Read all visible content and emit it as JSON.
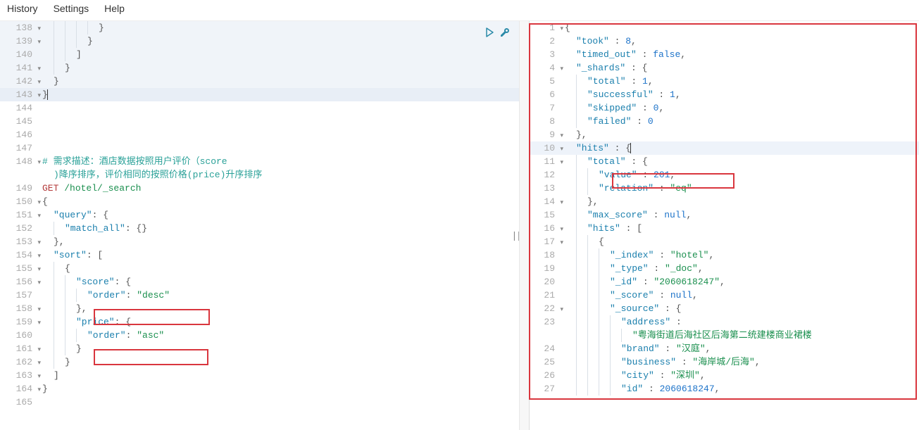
{
  "menu": {
    "history": "History",
    "settings": "Settings",
    "help": "Help"
  },
  "left": {
    "lines": [
      {
        "n": 138,
        "fold": true,
        "shade": true,
        "tokens": [
          [
            "indent",
            5
          ],
          [
            "punc",
            "}"
          ]
        ]
      },
      {
        "n": 139,
        "fold": true,
        "shade": true,
        "tokens": [
          [
            "indent",
            4
          ],
          [
            "punc",
            "}"
          ]
        ]
      },
      {
        "n": 140,
        "fold": false,
        "shade": true,
        "tokens": [
          [
            "indent",
            3
          ],
          [
            "punc",
            "]"
          ]
        ]
      },
      {
        "n": 141,
        "fold": true,
        "shade": true,
        "tokens": [
          [
            "indent",
            2
          ],
          [
            "punc",
            "}"
          ]
        ]
      },
      {
        "n": 142,
        "fold": true,
        "shade": true,
        "tokens": [
          [
            "indent",
            1
          ],
          [
            "punc",
            "}"
          ]
        ]
      },
      {
        "n": 143,
        "fold": true,
        "sel": true,
        "tokens": [
          [
            "punc",
            "}"
          ],
          [
            "cursor",
            ""
          ]
        ]
      },
      {
        "n": 144,
        "fold": false,
        "tokens": []
      },
      {
        "n": 145,
        "fold": false,
        "tokens": []
      },
      {
        "n": 146,
        "fold": false,
        "tokens": []
      },
      {
        "n": 147,
        "fold": false,
        "tokens": []
      },
      {
        "n": 148,
        "fold": true,
        "tokens": [
          [
            "cmt",
            "# 需求描述：酒店数据按照用户评价（score"
          ]
        ]
      },
      {
        "n": "",
        "fold": false,
        "tokens": [
          [
            "indent",
            1
          ],
          [
            "cmt",
            ")降序排序，评价相同的按照价格(price)升序排序"
          ]
        ]
      },
      {
        "n": 149,
        "fold": false,
        "tokens": [
          [
            "kw",
            "GET"
          ],
          [
            "txt",
            " "
          ],
          [
            "path",
            "/hotel/_search"
          ]
        ]
      },
      {
        "n": 150,
        "fold": true,
        "tokens": [
          [
            "punc",
            "{"
          ]
        ]
      },
      {
        "n": 151,
        "fold": true,
        "tokens": [
          [
            "indent",
            1
          ],
          [
            "key",
            "\"query\""
          ],
          [
            "punc",
            ": {"
          ]
        ]
      },
      {
        "n": 152,
        "fold": false,
        "tokens": [
          [
            "indent",
            2
          ],
          [
            "key",
            "\"match_all\""
          ],
          [
            "punc",
            ": {}"
          ]
        ]
      },
      {
        "n": 153,
        "fold": true,
        "tokens": [
          [
            "indent",
            1
          ],
          [
            "punc",
            "},"
          ]
        ]
      },
      {
        "n": 154,
        "fold": true,
        "tokens": [
          [
            "indent",
            1
          ],
          [
            "key",
            "\"sort\""
          ],
          [
            "punc",
            ": ["
          ]
        ]
      },
      {
        "n": 155,
        "fold": true,
        "tokens": [
          [
            "indent",
            2
          ],
          [
            "punc",
            "{"
          ]
        ]
      },
      {
        "n": 156,
        "fold": true,
        "tokens": [
          [
            "indent",
            3
          ],
          [
            "key",
            "\"score\""
          ],
          [
            "punc",
            ": {"
          ]
        ]
      },
      {
        "n": 157,
        "fold": false,
        "tokens": [
          [
            "indent",
            4
          ],
          [
            "key",
            "\"order\""
          ],
          [
            "punc",
            ": "
          ],
          [
            "str",
            "\"desc\""
          ]
        ]
      },
      {
        "n": 158,
        "fold": true,
        "tokens": [
          [
            "indent",
            3
          ],
          [
            "punc",
            "},"
          ]
        ]
      },
      {
        "n": 159,
        "fold": true,
        "tokens": [
          [
            "indent",
            3
          ],
          [
            "key",
            "\"price\""
          ],
          [
            "punc",
            ": {"
          ]
        ]
      },
      {
        "n": 160,
        "fold": false,
        "tokens": [
          [
            "indent",
            4
          ],
          [
            "key",
            "\"order\""
          ],
          [
            "punc",
            ": "
          ],
          [
            "str",
            "\"asc\""
          ]
        ]
      },
      {
        "n": 161,
        "fold": true,
        "tokens": [
          [
            "indent",
            3
          ],
          [
            "punc",
            "}"
          ]
        ]
      },
      {
        "n": 162,
        "fold": true,
        "tokens": [
          [
            "indent",
            2
          ],
          [
            "punc",
            "}"
          ]
        ]
      },
      {
        "n": 163,
        "fold": true,
        "tokens": [
          [
            "indent",
            1
          ],
          [
            "punc",
            "]"
          ]
        ]
      },
      {
        "n": 164,
        "fold": true,
        "tokens": [
          [
            "punc",
            "}"
          ]
        ]
      },
      {
        "n": 165,
        "fold": false,
        "tokens": []
      }
    ]
  },
  "right": {
    "lines": [
      {
        "n": 1,
        "fold": true,
        "tokens": [
          [
            "punc",
            "{"
          ]
        ]
      },
      {
        "n": 2,
        "fold": false,
        "tokens": [
          [
            "indent",
            1
          ],
          [
            "key",
            "\"took\""
          ],
          [
            "punc",
            " : "
          ],
          [
            "num",
            "8"
          ],
          [
            "punc",
            ","
          ]
        ]
      },
      {
        "n": 3,
        "fold": false,
        "tokens": [
          [
            "indent",
            1
          ],
          [
            "key",
            "\"timed_out\""
          ],
          [
            "punc",
            " : "
          ],
          [
            "bool",
            "false"
          ],
          [
            "punc",
            ","
          ]
        ]
      },
      {
        "n": 4,
        "fold": true,
        "tokens": [
          [
            "indent",
            1
          ],
          [
            "key",
            "\"_shards\""
          ],
          [
            "punc",
            " : {"
          ]
        ]
      },
      {
        "n": 5,
        "fold": false,
        "tokens": [
          [
            "indent",
            2
          ],
          [
            "key",
            "\"total\""
          ],
          [
            "punc",
            " : "
          ],
          [
            "num",
            "1"
          ],
          [
            "punc",
            ","
          ]
        ]
      },
      {
        "n": 6,
        "fold": false,
        "tokens": [
          [
            "indent",
            2
          ],
          [
            "key",
            "\"successful\""
          ],
          [
            "punc",
            " : "
          ],
          [
            "num",
            "1"
          ],
          [
            "punc",
            ","
          ]
        ]
      },
      {
        "n": 7,
        "fold": false,
        "tokens": [
          [
            "indent",
            2
          ],
          [
            "key",
            "\"skipped\""
          ],
          [
            "punc",
            " : "
          ],
          [
            "num",
            "0"
          ],
          [
            "punc",
            ","
          ]
        ]
      },
      {
        "n": 8,
        "fold": false,
        "tokens": [
          [
            "indent",
            2
          ],
          [
            "key",
            "\"failed\""
          ],
          [
            "punc",
            " : "
          ],
          [
            "num",
            "0"
          ]
        ]
      },
      {
        "n": 9,
        "fold": true,
        "tokens": [
          [
            "indent",
            1
          ],
          [
            "punc",
            "},"
          ]
        ]
      },
      {
        "n": 10,
        "fold": true,
        "rsel": true,
        "tokens": [
          [
            "indent",
            1
          ],
          [
            "key",
            "\"hits\""
          ],
          [
            "punc",
            " : {"
          ],
          [
            "cursor",
            ""
          ]
        ]
      },
      {
        "n": 11,
        "fold": true,
        "tokens": [
          [
            "indent",
            2
          ],
          [
            "key",
            "\"total\""
          ],
          [
            "punc",
            " : {"
          ]
        ]
      },
      {
        "n": 12,
        "fold": false,
        "tokens": [
          [
            "indent",
            3
          ],
          [
            "key",
            "\"value\""
          ],
          [
            "punc",
            " : "
          ],
          [
            "num",
            "201"
          ],
          [
            "punc",
            ","
          ]
        ]
      },
      {
        "n": 13,
        "fold": false,
        "tokens": [
          [
            "indent",
            3
          ],
          [
            "key",
            "\"relation\""
          ],
          [
            "punc",
            " : "
          ],
          [
            "str",
            "\"eq\""
          ]
        ]
      },
      {
        "n": 14,
        "fold": true,
        "tokens": [
          [
            "indent",
            2
          ],
          [
            "punc",
            "},"
          ]
        ]
      },
      {
        "n": 15,
        "fold": false,
        "tokens": [
          [
            "indent",
            2
          ],
          [
            "key",
            "\"max_score\""
          ],
          [
            "punc",
            " : "
          ],
          [
            "bool",
            "null"
          ],
          [
            "punc",
            ","
          ]
        ]
      },
      {
        "n": 16,
        "fold": true,
        "tokens": [
          [
            "indent",
            2
          ],
          [
            "key",
            "\"hits\""
          ],
          [
            "punc",
            " : ["
          ]
        ]
      },
      {
        "n": 17,
        "fold": true,
        "tokens": [
          [
            "indent",
            3
          ],
          [
            "punc",
            "{"
          ]
        ]
      },
      {
        "n": 18,
        "fold": false,
        "tokens": [
          [
            "indent",
            4
          ],
          [
            "key",
            "\"_index\""
          ],
          [
            "punc",
            " : "
          ],
          [
            "str",
            "\"hotel\""
          ],
          [
            "punc",
            ","
          ]
        ]
      },
      {
        "n": 19,
        "fold": false,
        "tokens": [
          [
            "indent",
            4
          ],
          [
            "key",
            "\"_type\""
          ],
          [
            "punc",
            " : "
          ],
          [
            "str",
            "\"_doc\""
          ],
          [
            "punc",
            ","
          ]
        ]
      },
      {
        "n": 20,
        "fold": false,
        "tokens": [
          [
            "indent",
            4
          ],
          [
            "key",
            "\"_id\""
          ],
          [
            "punc",
            " : "
          ],
          [
            "str",
            "\"2060618247\""
          ],
          [
            "punc",
            ","
          ]
        ]
      },
      {
        "n": 21,
        "fold": false,
        "tokens": [
          [
            "indent",
            4
          ],
          [
            "key",
            "\"_score\""
          ],
          [
            "punc",
            " : "
          ],
          [
            "bool",
            "null"
          ],
          [
            "punc",
            ","
          ]
        ]
      },
      {
        "n": 22,
        "fold": true,
        "tokens": [
          [
            "indent",
            4
          ],
          [
            "key",
            "\"_source\""
          ],
          [
            "punc",
            " : {"
          ]
        ]
      },
      {
        "n": 23,
        "fold": false,
        "tokens": [
          [
            "indent",
            5
          ],
          [
            "key",
            "\"address\""
          ],
          [
            "punc",
            " : "
          ]
        ]
      },
      {
        "n": "",
        "fold": false,
        "tokens": [
          [
            "indent",
            6
          ],
          [
            "str",
            "\"粤海街道后海社区后海第二统建楼商业裙楼"
          ]
        ]
      },
      {
        "n": 24,
        "fold": false,
        "tokens": [
          [
            "indent",
            5
          ],
          [
            "key",
            "\"brand\""
          ],
          [
            "punc",
            " : "
          ],
          [
            "str",
            "\"汉庭\""
          ],
          [
            "punc",
            ","
          ]
        ]
      },
      {
        "n": 25,
        "fold": false,
        "tokens": [
          [
            "indent",
            5
          ],
          [
            "key",
            "\"business\""
          ],
          [
            "punc",
            " : "
          ],
          [
            "str",
            "\"海岸城/后海\""
          ],
          [
            "punc",
            ","
          ]
        ]
      },
      {
        "n": 26,
        "fold": false,
        "tokens": [
          [
            "indent",
            5
          ],
          [
            "key",
            "\"city\""
          ],
          [
            "punc",
            " : "
          ],
          [
            "str",
            "\"深圳\""
          ],
          [
            "punc",
            ","
          ]
        ]
      },
      {
        "n": 27,
        "fold": false,
        "tokens": [
          [
            "indent",
            5
          ],
          [
            "key",
            "\"id\""
          ],
          [
            "punc",
            " : "
          ],
          [
            "num",
            "2060618247"
          ],
          [
            "punc",
            ","
          ]
        ]
      }
    ]
  }
}
